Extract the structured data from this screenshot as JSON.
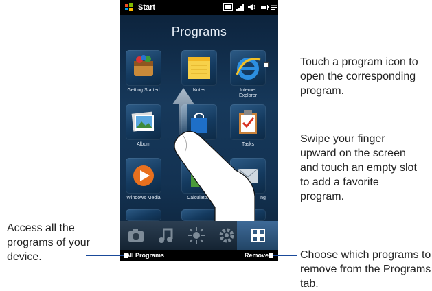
{
  "statusbar": {
    "start_label": "Start"
  },
  "screen": {
    "title": "Programs",
    "programs": [
      {
        "label": "Getting Started"
      },
      {
        "label": "Notes"
      },
      {
        "label": "Internet\nExplorer"
      },
      {
        "label": "Album"
      },
      {
        "label": "Tasks"
      },
      {
        "label": "Windows Media"
      },
      {
        "label": "Calculator"
      },
      {
        "label": "ng"
      }
    ],
    "tabs": [
      "photos-tab",
      "music-tab",
      "weather-tab",
      "settings-tab",
      "programs-tab"
    ],
    "softkeys": {
      "left": "All Programs",
      "right": "Remove"
    }
  },
  "callouts": {
    "touch_icon": "Touch a program icon to open the corresponding program.",
    "swipe": "Swipe your finger upward on the screen and touch an empty slot to add a favorite program.",
    "access_all": "Access all the programs of your device.",
    "remove": "Choose which programs to remove from the Programs tab."
  },
  "colors": {
    "accent_line": "#1a4a9a",
    "screen_bg": "#16385a"
  }
}
